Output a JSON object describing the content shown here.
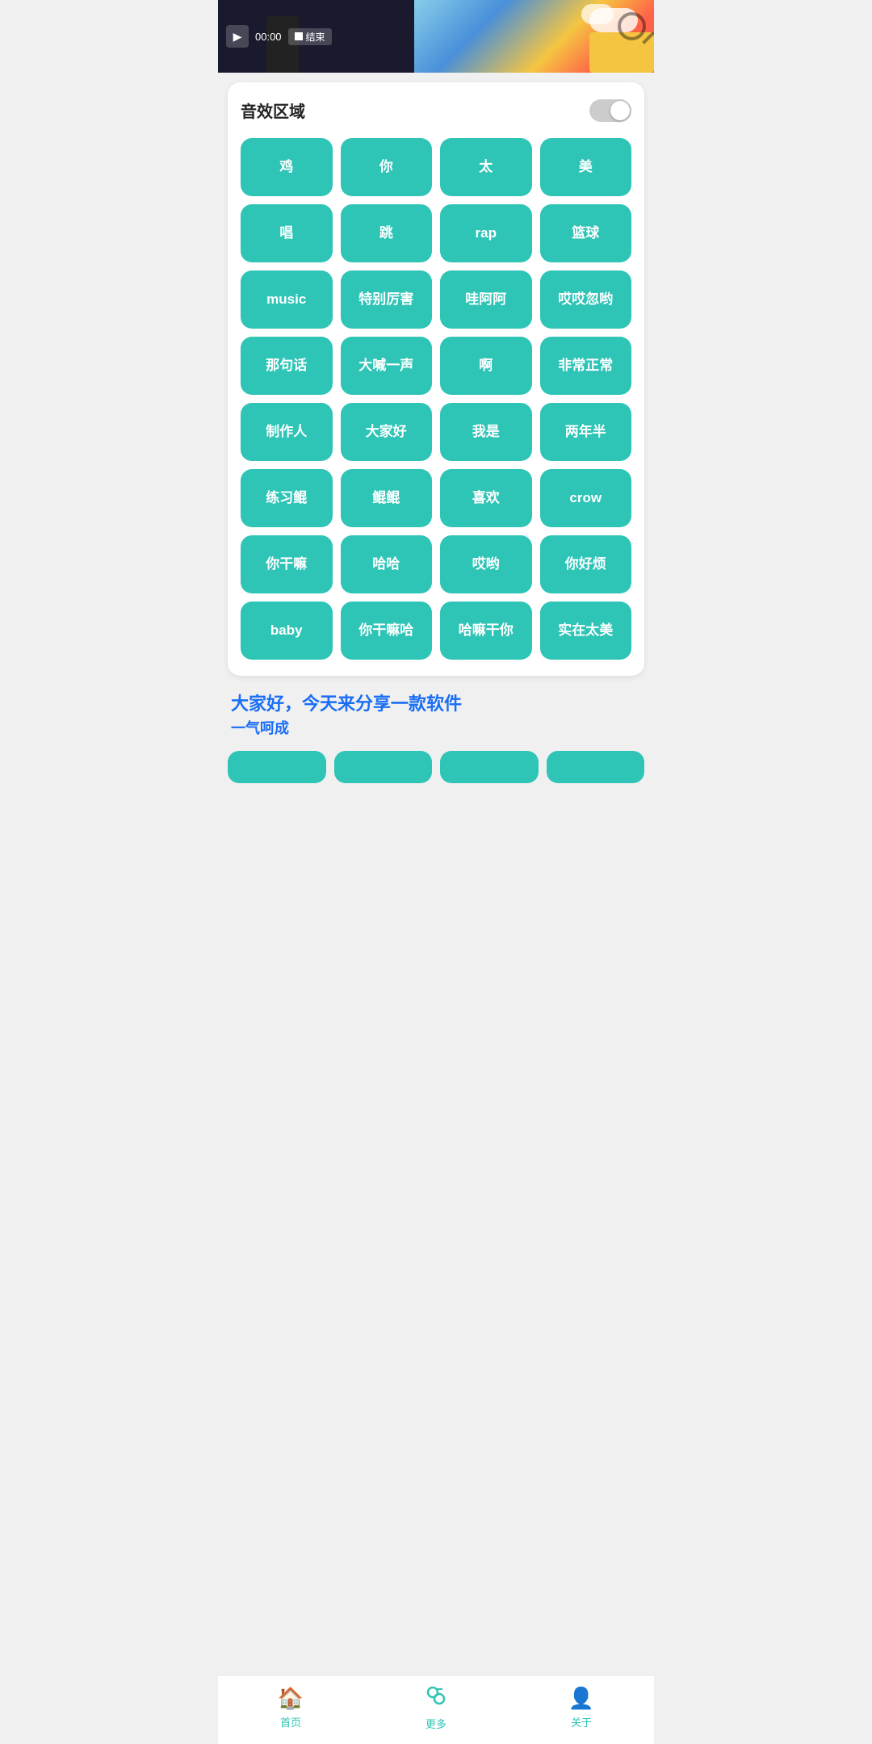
{
  "header": {
    "time": "00:00",
    "end_label": "结束"
  },
  "card": {
    "title": "音效区域",
    "toggle_state": false
  },
  "buttons": [
    {
      "id": "btn-1",
      "label": "鸡"
    },
    {
      "id": "btn-2",
      "label": "你"
    },
    {
      "id": "btn-3",
      "label": "太"
    },
    {
      "id": "btn-4",
      "label": "美"
    },
    {
      "id": "btn-5",
      "label": "唱"
    },
    {
      "id": "btn-6",
      "label": "跳"
    },
    {
      "id": "btn-7",
      "label": "rap"
    },
    {
      "id": "btn-8",
      "label": "篮球"
    },
    {
      "id": "btn-9",
      "label": "music"
    },
    {
      "id": "btn-10",
      "label": "特别厉害"
    },
    {
      "id": "btn-11",
      "label": "哇阿阿"
    },
    {
      "id": "btn-12",
      "label": "哎哎忽哟"
    },
    {
      "id": "btn-13",
      "label": "那句话"
    },
    {
      "id": "btn-14",
      "label": "大喊一声"
    },
    {
      "id": "btn-15",
      "label": "啊"
    },
    {
      "id": "btn-16",
      "label": "非常正常"
    },
    {
      "id": "btn-17",
      "label": "制作人"
    },
    {
      "id": "btn-18",
      "label": "大家好"
    },
    {
      "id": "btn-19",
      "label": "我是"
    },
    {
      "id": "btn-20",
      "label": "两年半"
    },
    {
      "id": "btn-21",
      "label": "练习鲲"
    },
    {
      "id": "btn-22",
      "label": "鲲鲲"
    },
    {
      "id": "btn-23",
      "label": "喜欢"
    },
    {
      "id": "btn-24",
      "label": "crow"
    },
    {
      "id": "btn-25",
      "label": "你干嘛"
    },
    {
      "id": "btn-26",
      "label": "哈哈"
    },
    {
      "id": "btn-27",
      "label": "哎哟"
    },
    {
      "id": "btn-28",
      "label": "你好烦"
    },
    {
      "id": "btn-29",
      "label": "baby"
    },
    {
      "id": "btn-30",
      "label": "你干嘛哈"
    },
    {
      "id": "btn-31",
      "label": "哈嘛干你"
    },
    {
      "id": "btn-32",
      "label": "实在太美"
    }
  ],
  "subtitle": {
    "line1": "大家好，今天来分享一款软件",
    "line2": "一气呵成"
  },
  "bottom_partial_buttons": [
    {
      "id": "partial-1",
      "label": ""
    },
    {
      "id": "partial-2",
      "label": ""
    },
    {
      "id": "partial-3",
      "label": ""
    },
    {
      "id": "partial-4",
      "label": ""
    }
  ],
  "nav": {
    "items": [
      {
        "id": "nav-home",
        "label": "首页",
        "icon": "🏠"
      },
      {
        "id": "nav-more",
        "label": "更多",
        "icon": "🔄"
      },
      {
        "id": "nav-about",
        "label": "关于",
        "icon": "👤"
      }
    ]
  }
}
